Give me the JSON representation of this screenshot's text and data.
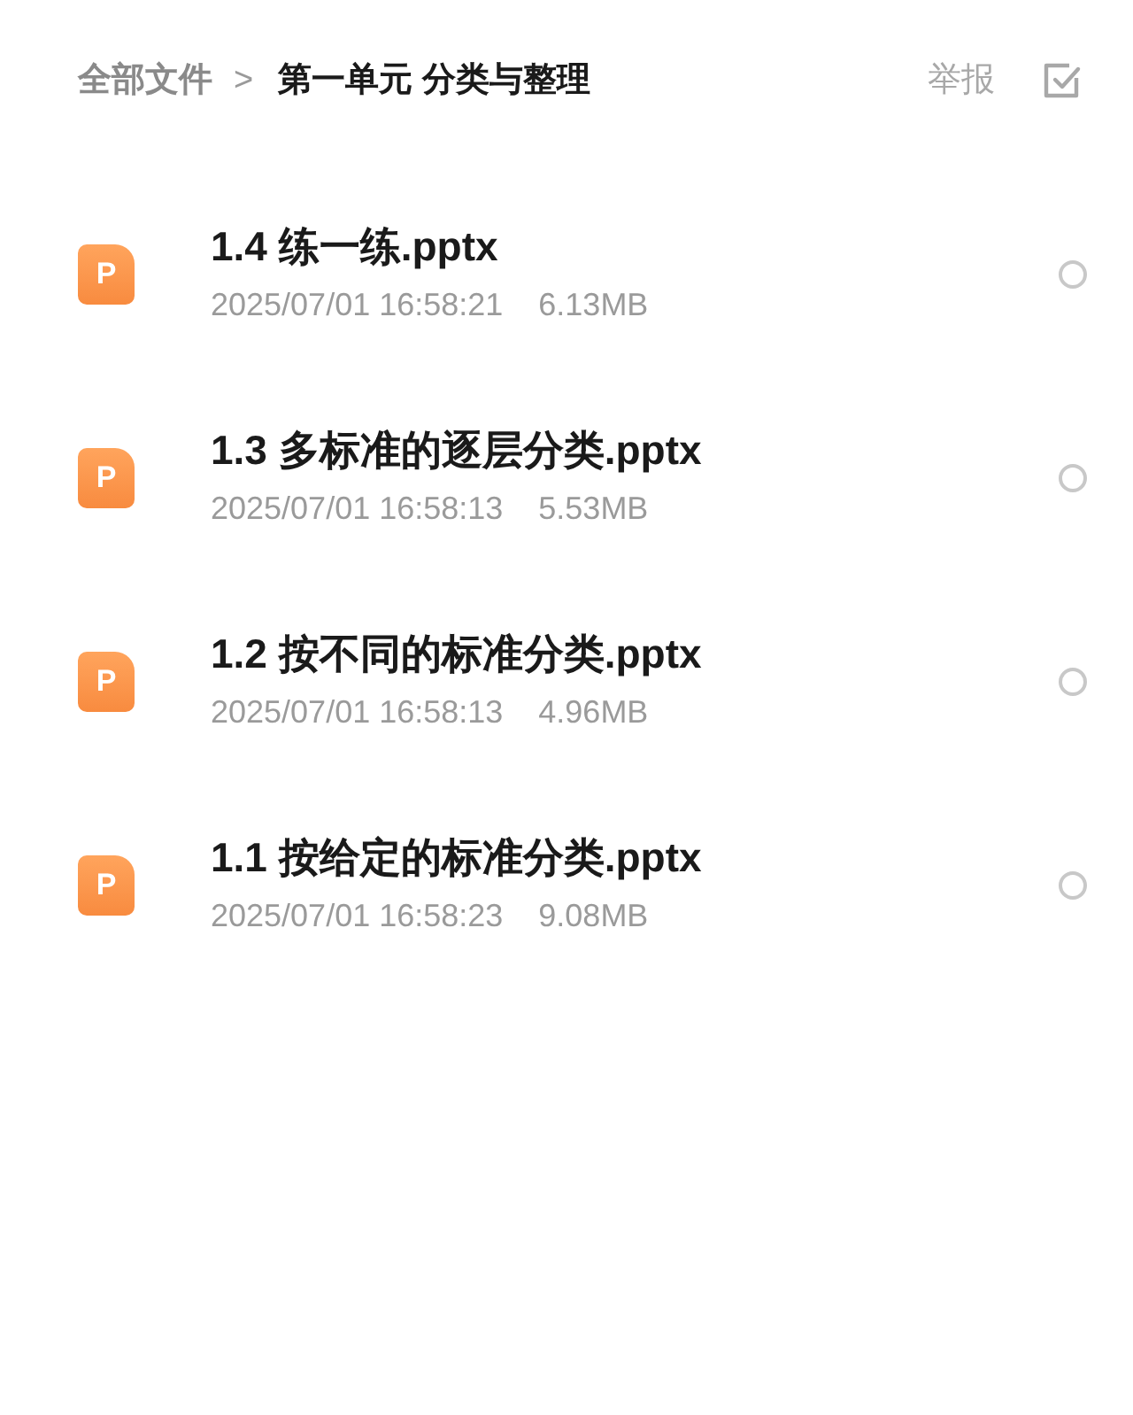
{
  "breadcrumb": {
    "root": "全部文件",
    "separator": ">",
    "current": "第一单元 分类与整理"
  },
  "report_link": "举报",
  "files": [
    {
      "icon_letter": "P",
      "name": "1.4 练一练.pptx",
      "time": "2025/07/01 16:58:21",
      "size": "6.13MB",
      "selected": false
    },
    {
      "icon_letter": "P",
      "name": "1.3 多标准的逐层分类.pptx",
      "time": "2025/07/01 16:58:13",
      "size": "5.53MB",
      "selected": false
    },
    {
      "icon_letter": "P",
      "name": "1.2 按不同的标准分类.pptx",
      "time": "2025/07/01 16:58:13",
      "size": "4.96MB",
      "selected": false
    },
    {
      "icon_letter": "P",
      "name": "1.1 按给定的标准分类.pptx",
      "time": "2025/07/01 16:58:23",
      "size": "9.08MB",
      "selected": false
    }
  ]
}
